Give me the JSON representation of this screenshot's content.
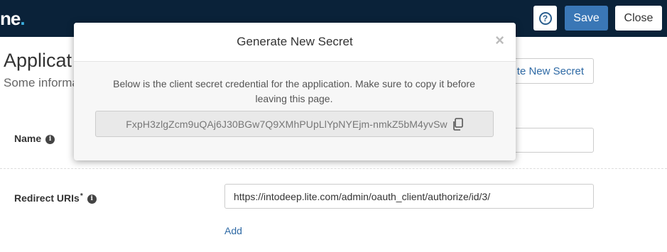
{
  "topbar": {
    "brand_text": "ne",
    "brand_dot": ".",
    "help_icon_text": "?",
    "save_label": "Save",
    "close_label": "Close"
  },
  "page": {
    "title": "Applicat",
    "subtitle": "Some informa",
    "generate_button_partial": "te New Secret",
    "name_label": "Name",
    "redirect_label": "Redirect URIs",
    "required_mark": "*",
    "redirect_uri_value": "https://intodeep.lite.com/admin/oauth_client/authorize/id/3/",
    "add_label": "Add",
    "info_icon_glyph": "i"
  },
  "modal": {
    "title": "Generate New Secret",
    "close_glyph": "×",
    "description": "Below is the client secret credential for the application. Make sure to copy it before leaving this page.",
    "secret_value": "FxpH3zlgZcm9uQAj6J30BGw7Q9XMhPUpLlYpNYEjm-nmkZ5bM4yvSw"
  },
  "colors": {
    "topbar_bg": "#0a2239",
    "accent_blue": "#3a77b6",
    "link_blue": "#2f6aa5"
  }
}
